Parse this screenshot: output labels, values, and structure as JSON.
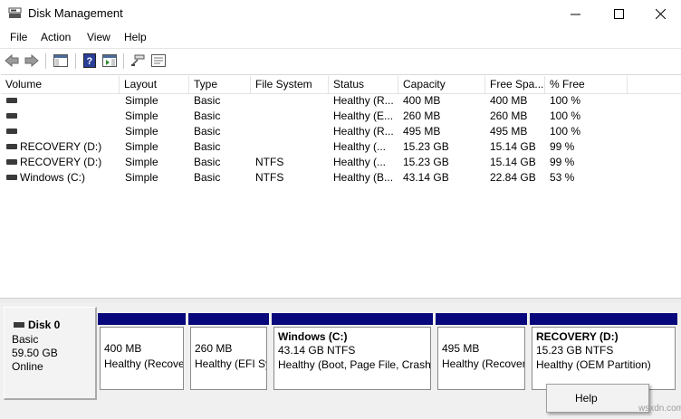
{
  "window": {
    "title": "Disk Management"
  },
  "menu": [
    "File",
    "Action",
    "View",
    "Help"
  ],
  "toolbar": {
    "icons": [
      "back-arrow-icon",
      "forward-arrow-icon",
      "show-hide-console-tree-icon",
      "help-icon",
      "show-hide-action-pane-icon",
      "connect-icon",
      "properties-icon"
    ]
  },
  "table": {
    "columns": [
      "Volume",
      "Layout",
      "Type",
      "File System",
      "Status",
      "Capacity",
      "Free Spa...",
      "% Free"
    ],
    "rows": [
      [
        "",
        "Simple",
        "Basic",
        "",
        "Healthy (R...",
        "400 MB",
        "400 MB",
        "100 %"
      ],
      [
        "",
        "Simple",
        "Basic",
        "",
        "Healthy (E...",
        "260 MB",
        "260 MB",
        "100 %"
      ],
      [
        "",
        "Simple",
        "Basic",
        "",
        "Healthy (R...",
        "495 MB",
        "495 MB",
        "100 %"
      ],
      [
        "RECOVERY (D:)",
        "Simple",
        "Basic",
        "",
        "Healthy (...",
        "15.23 GB",
        "15.14 GB",
        "99 %"
      ],
      [
        "RECOVERY (D:)",
        "Simple",
        "Basic",
        "NTFS",
        "Healthy (...",
        "15.23 GB",
        "15.14 GB",
        "99 %"
      ],
      [
        "Windows (C:)",
        "Simple",
        "Basic",
        "NTFS",
        "Healthy (B...",
        "43.14 GB",
        "22.84 GB",
        "53 %"
      ]
    ]
  },
  "disk": {
    "name": "Disk 0",
    "type": "Basic",
    "size": "59.50 GB",
    "state": "Online"
  },
  "partitions": [
    {
      "line1": "400 MB",
      "line2": "Healthy (Recovery Partition)"
    },
    {
      "line1": "260 MB",
      "line2": "Healthy (EFI System Partition)"
    },
    {
      "name": "Windows  (C:)",
      "size": "43.14 GB NTFS",
      "status": "Healthy (Boot, Page File, Crash Dump, Primary Partition)"
    },
    {
      "line1": "495 MB",
      "line2": "Healthy (Recovery Partition)"
    },
    {
      "name": "RECOVERY  (D:)",
      "size": "15.23 GB NTFS",
      "status": "Healthy (OEM Partition)"
    }
  ],
  "context_menu": {
    "item": "Help"
  },
  "watermark": "wsxdn.com",
  "colors": {
    "partition_bar": "#08087c",
    "background": "#f0f0f0"
  }
}
